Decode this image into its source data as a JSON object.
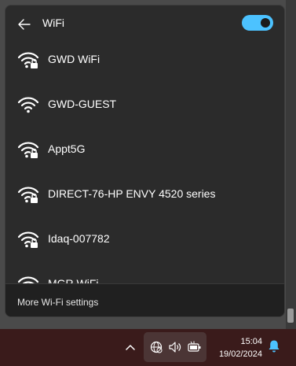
{
  "header": {
    "title": "WiFi",
    "back_icon": "arrow-left-icon",
    "toggle_state": "on"
  },
  "networks": [
    {
      "name": "GWD WiFi",
      "secured": true,
      "icon": "wifi-lock-icon"
    },
    {
      "name": "GWD-GUEST",
      "secured": false,
      "icon": "wifi-icon"
    },
    {
      "name": "Appt5G",
      "secured": true,
      "icon": "wifi-lock-icon"
    },
    {
      "name": "DIRECT-76-HP ENVY 4520 series",
      "secured": true,
      "icon": "wifi-lock-icon"
    },
    {
      "name": "Idaq-007782",
      "secured": true,
      "icon": "wifi-lock-icon"
    },
    {
      "name": "MGR WiFi",
      "secured": true,
      "icon": "wifi-lock-icon"
    }
  ],
  "footer": {
    "link": "More Wi-Fi settings"
  },
  "taskbar": {
    "time": "15:04",
    "date": "19/02/2024"
  },
  "colors": {
    "accent": "#4cc2ff",
    "panel": "#2b2b2b",
    "taskbar": "#3a1b1b"
  }
}
